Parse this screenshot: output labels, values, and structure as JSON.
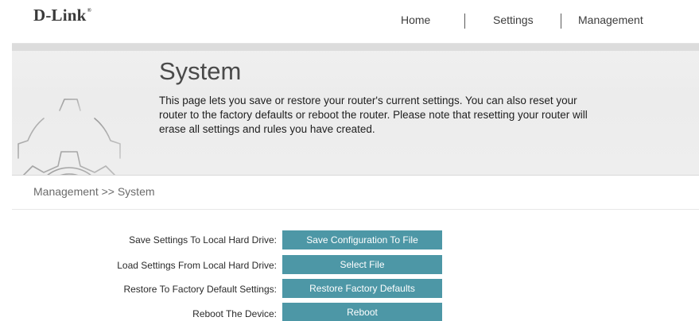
{
  "header": {
    "logo_text": "D-Link",
    "logo_mark": "®",
    "nav": [
      {
        "label": "Home"
      },
      {
        "label": "Settings"
      },
      {
        "label": "Management"
      }
    ]
  },
  "banner": {
    "title": "System",
    "description_lines": [
      "This page lets you save or restore your router's current settings. You can also reset your",
      "router to the factory defaults or reboot the router. Please note that resetting your router will",
      "erase all settings and rules you have created."
    ],
    "icon": "gear-icon"
  },
  "breadcrumb": "Management >> System",
  "rows": [
    {
      "label": "Save Settings To Local Hard Drive:",
      "button": "Save Configuration To File"
    },
    {
      "label": "Load Settings From Local Hard Drive:",
      "button": "Select File"
    },
    {
      "label": "Restore To Factory Default Settings:",
      "button": "Restore Factory Defaults"
    },
    {
      "label": "Reboot The Device:",
      "button": "Reboot"
    }
  ],
  "colors": {
    "accent_button": "#4d97a6",
    "banner_bg": "#eeeeee",
    "text": "#1e1e1e"
  }
}
